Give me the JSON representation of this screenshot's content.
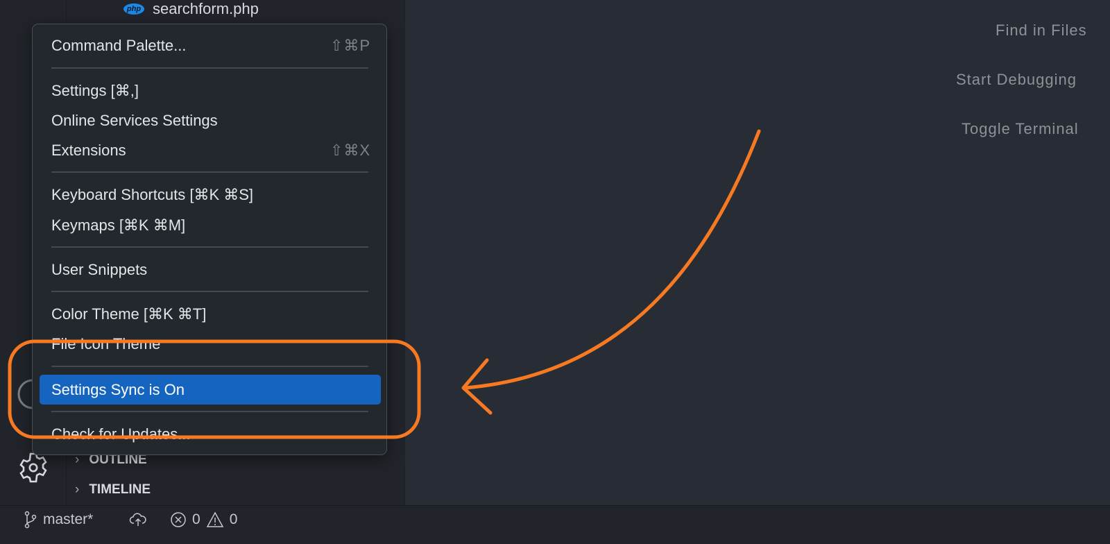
{
  "sidebar": {
    "file": {
      "name": "searchform.php",
      "badge": "php"
    },
    "sections": [
      {
        "label": "OUTLINE"
      },
      {
        "label": "TIMELINE"
      }
    ]
  },
  "editor": {
    "hints": [
      "Find in Files",
      "Start Debugging",
      "Toggle Terminal"
    ]
  },
  "menu": {
    "items": [
      {
        "label": "Command Palette...",
        "shortcut": "⇧⌘P"
      },
      {
        "label": "Settings [⌘,]",
        "shortcut": ""
      },
      {
        "label": "Online Services Settings",
        "shortcut": ""
      },
      {
        "label": "Extensions",
        "shortcut": "⇧⌘X"
      },
      {
        "label": "Keyboard Shortcuts [⌘K ⌘S]",
        "shortcut": ""
      },
      {
        "label": "Keymaps [⌘K ⌘M]",
        "shortcut": ""
      },
      {
        "label": "User Snippets",
        "shortcut": ""
      },
      {
        "label": "Color Theme [⌘K ⌘T]",
        "shortcut": ""
      },
      {
        "label": "File Icon Theme",
        "shortcut": ""
      },
      {
        "label": "Settings Sync is On",
        "shortcut": "",
        "selected": true
      },
      {
        "label": "Check for Updates...",
        "shortcut": ""
      }
    ]
  },
  "status": {
    "branch": "master*",
    "errors": "0",
    "warnings": "0"
  },
  "annotation": {
    "color": "#f77a22"
  }
}
